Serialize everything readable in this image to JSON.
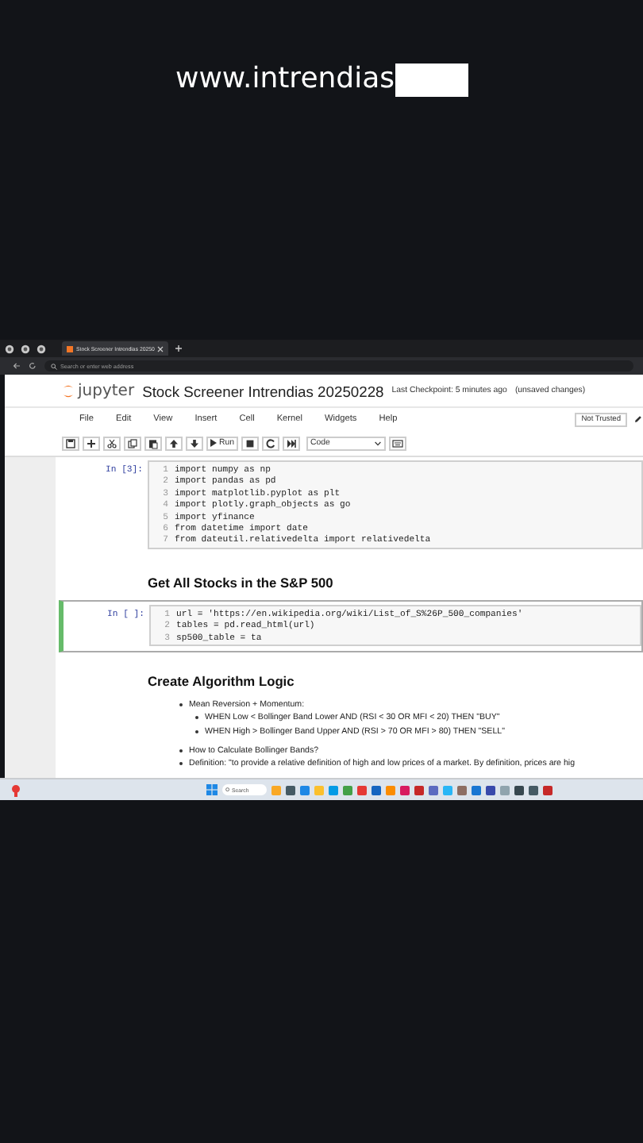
{
  "caption": {
    "text": "www.intrendias"
  },
  "browser": {
    "tab_title": "Stock Screener Intrendias 20250",
    "address_placeholder": "Search or enter web address"
  },
  "notebook": {
    "title": "Stock Screener Intrendias 20250228",
    "checkpoint": "Last Checkpoint: 5 minutes ago",
    "unsaved": "(unsaved changes)",
    "logo_text": "jupyter",
    "trusted": "Not Trusted",
    "run_label": "Run",
    "cell_type": "Code",
    "menu": [
      "File",
      "Edit",
      "View",
      "Insert",
      "Cell",
      "Kernel",
      "Widgets",
      "Help"
    ]
  },
  "cells": [
    {
      "kind": "code",
      "prompt": "In [3]:",
      "selected": false,
      "lines": [
        {
          "n": "1",
          "code": "import numpy as np"
        },
        {
          "n": "2",
          "code": "import pandas as pd"
        },
        {
          "n": "3",
          "code": "import matplotlib.pyplot as plt"
        },
        {
          "n": "4",
          "code": "import plotly.graph_objects as go"
        },
        {
          "n": "5",
          "code": "import yfinance"
        },
        {
          "n": "6",
          "code": "from datetime import date"
        },
        {
          "n": "7",
          "code": "from dateutil.relativedelta import relativedelta"
        }
      ]
    },
    {
      "kind": "heading",
      "text": "Get All Stocks in the S&P 500"
    },
    {
      "kind": "code",
      "prompt": "In [ ]:",
      "selected": true,
      "lines": [
        {
          "n": "1",
          "code": "url = 'https://en.wikipedia.org/wiki/List_of_S%26P_500_companies'"
        },
        {
          "n": "2",
          "code": "tables = pd.read_html(url)"
        },
        {
          "n": "3",
          "code": "sp500_table = ta"
        }
      ]
    },
    {
      "kind": "heading",
      "text": "Create Algorithm Logic"
    },
    {
      "kind": "bullets",
      "items": [
        {
          "text": "Mean Reversion + Momentum:",
          "children": [
            {
              "text": "WHEN Low < Bollinger Band Lower AND (RSI < 30 OR MFI < 20) THEN \"BUY\""
            },
            {
              "text": "WHEN High > Bollinger Band Upper AND (RSI > 70 OR MFI > 80) THEN \"SELL\""
            }
          ]
        },
        {
          "text": "How to Calculate Bollinger Bands?"
        },
        {
          "text": "Definition: \"to provide a relative definition of high and low prices of a market. By definition, prices are hig"
        }
      ]
    }
  ],
  "taskbar": {
    "search_placeholder": "Search"
  }
}
